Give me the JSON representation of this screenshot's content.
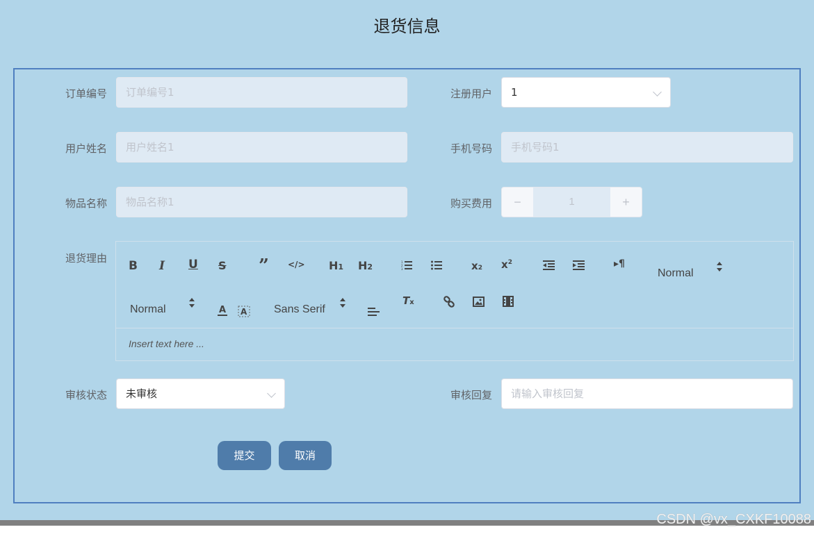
{
  "page": {
    "title": "退货信息"
  },
  "form": {
    "order_no": {
      "label": "订单编号",
      "placeholder": "订单编号1"
    },
    "registered_user": {
      "label": "注册用户",
      "value": "1"
    },
    "user_name": {
      "label": "用户姓名",
      "placeholder": "用户姓名1"
    },
    "phone": {
      "label": "手机号码",
      "placeholder": "手机号码1"
    },
    "item_name": {
      "label": "物品名称",
      "placeholder": "物品名称1"
    },
    "purchase_fee": {
      "label": "购买费用",
      "value": "1",
      "minus": "−",
      "plus": "+"
    },
    "return_reason": {
      "label": "退货理由"
    },
    "review_status": {
      "label": "审核状态",
      "value": "未审核"
    },
    "review_reply": {
      "label": "审核回复",
      "placeholder": "请输入审核回复"
    }
  },
  "editor": {
    "header_select": "Normal",
    "size_select": "Normal",
    "font_select": "Sans Serif",
    "h1": "H",
    "h2": "H",
    "placeholder": "Insert text here ..."
  },
  "buttons": {
    "submit": "提交",
    "cancel": "取消"
  },
  "watermark": "CSDN @vx_CXKF10088"
}
